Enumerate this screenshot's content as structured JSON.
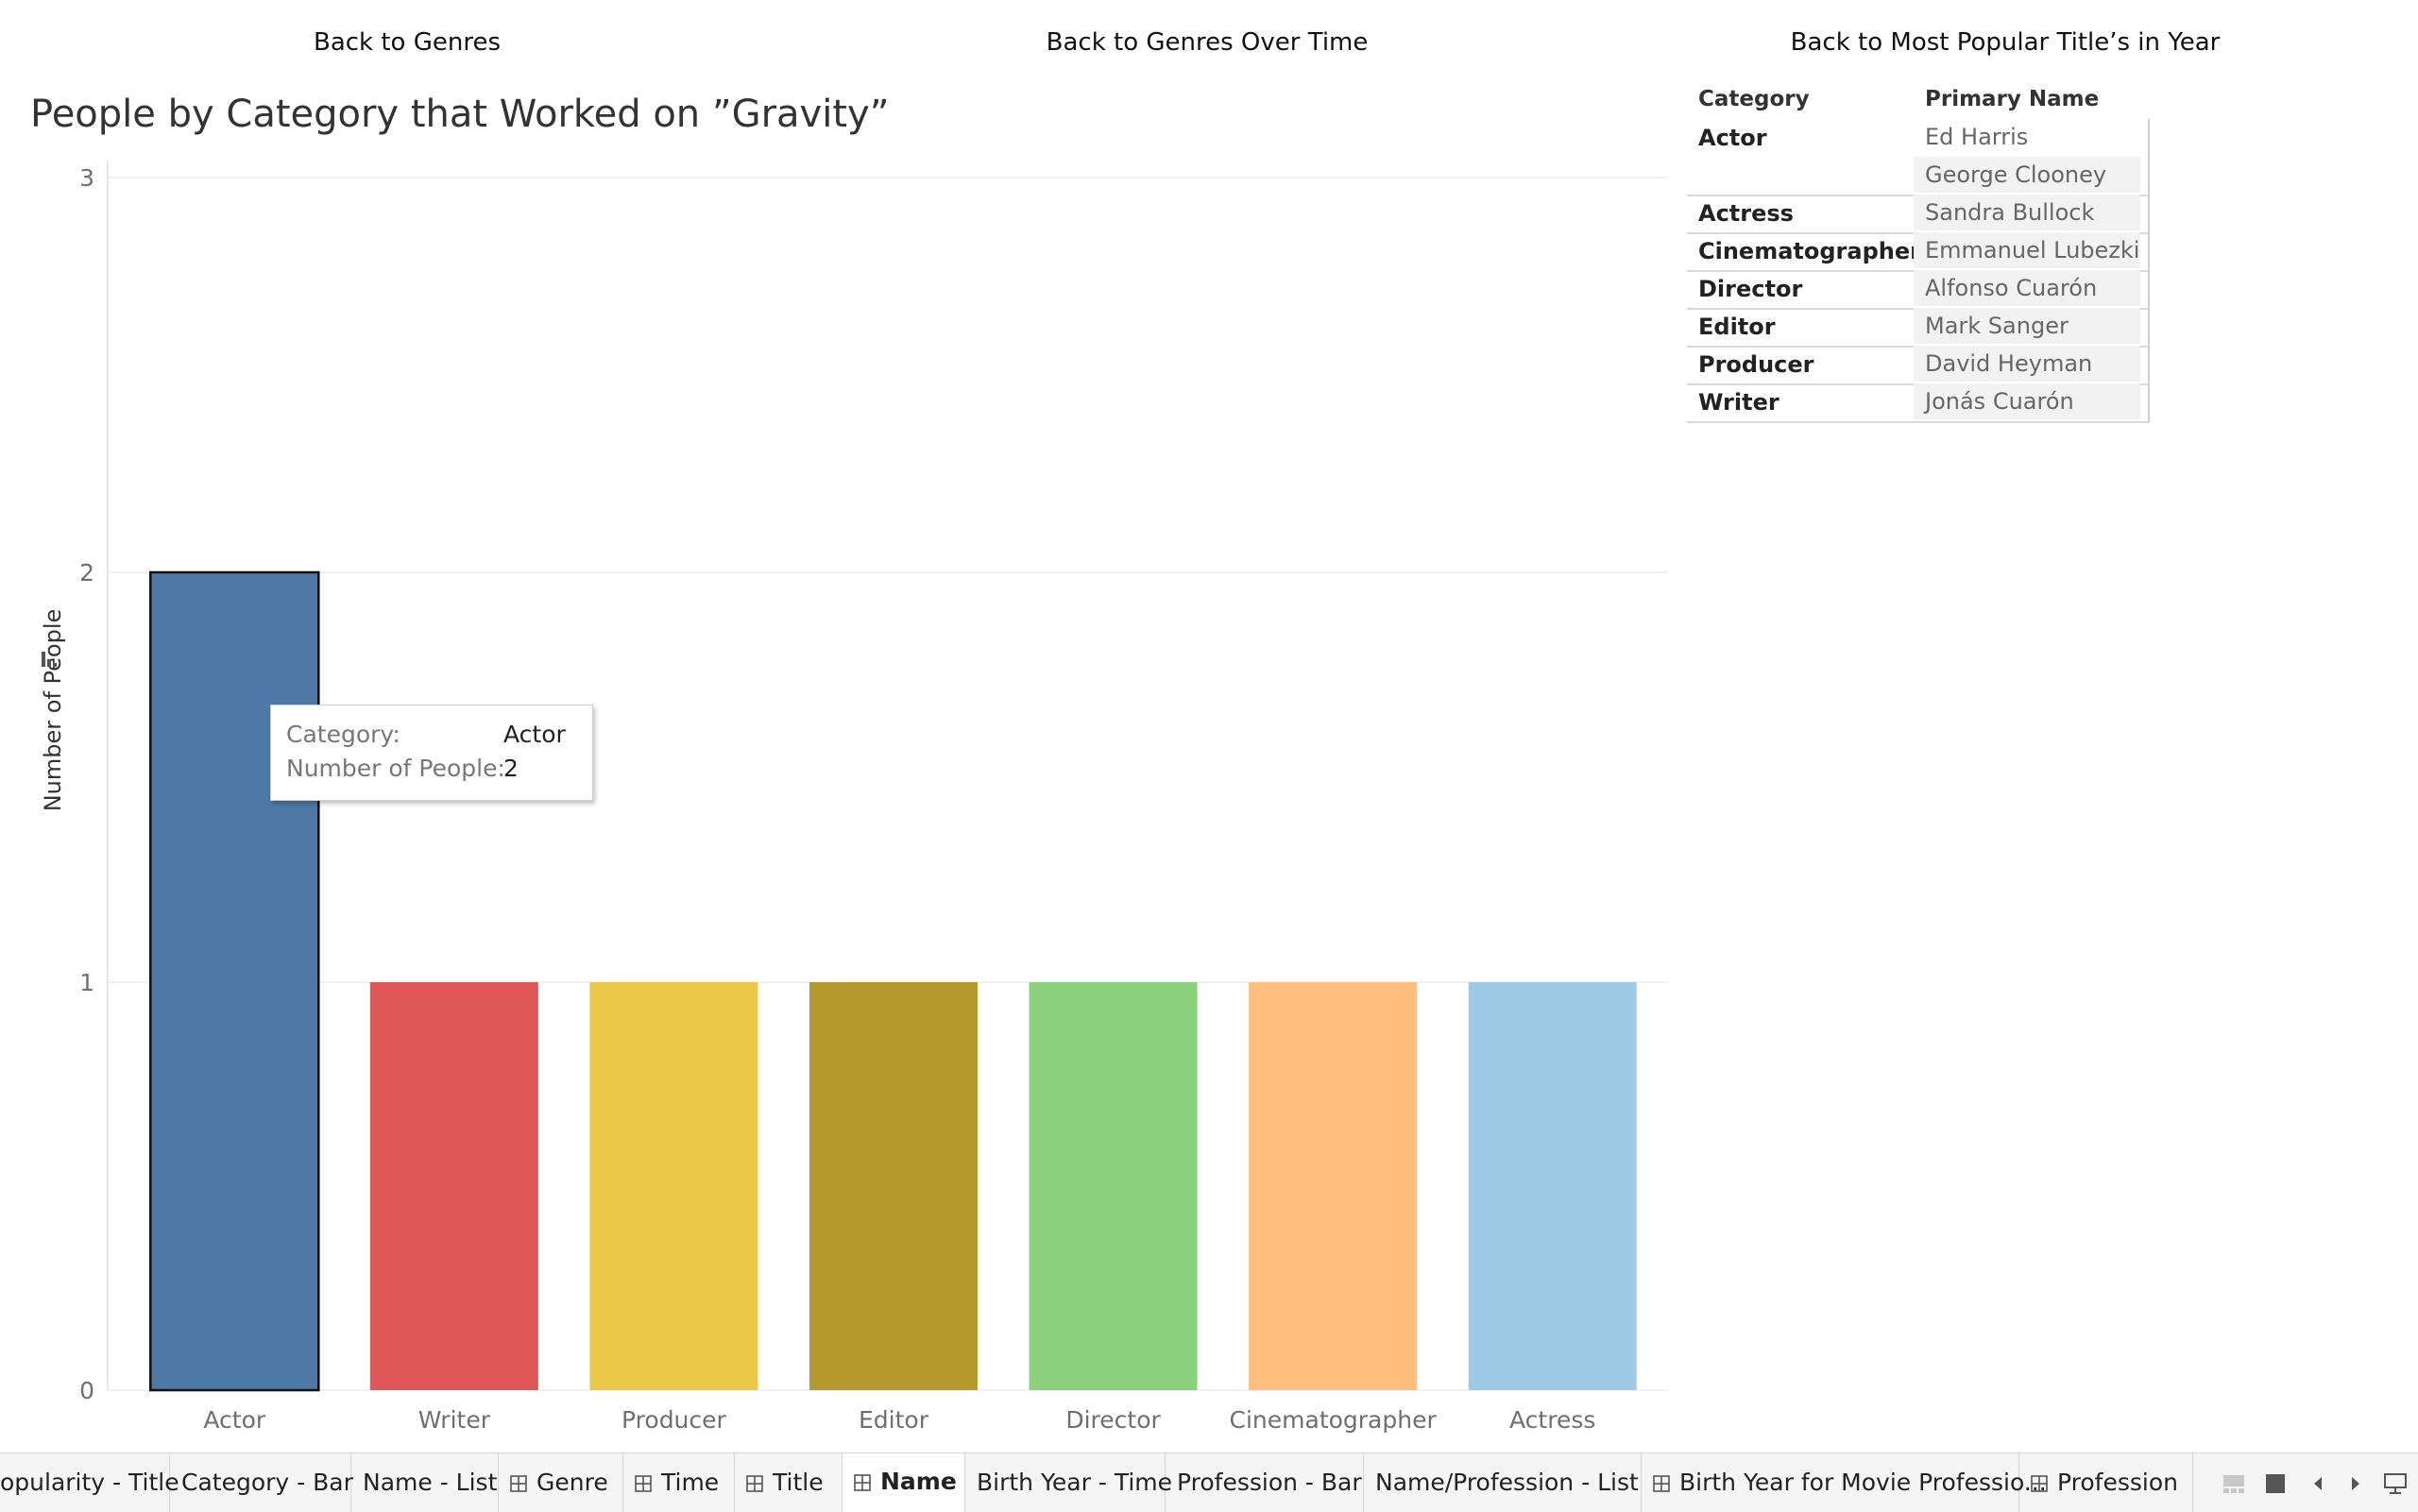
{
  "nav": {
    "back_genres": "Back to Genres",
    "back_genres_time": "Back to Genres Over Time",
    "back_popular": "Back to Most Popular Title’s in Year"
  },
  "chart_data": {
    "type": "bar",
    "title": "People by Category that Worked on ”Gravity”",
    "xlabel": "",
    "ylabel": "Number of People",
    "ylim": [
      0,
      3
    ],
    "yticks": [
      0,
      1,
      2,
      3
    ],
    "categories": [
      "Actor",
      "Writer",
      "Producer",
      "Editor",
      "Director",
      "Cinematographer",
      "Actress"
    ],
    "values": [
      2,
      1,
      1,
      1,
      1,
      1,
      1
    ],
    "colors": [
      "#4e79a7",
      "#e15759",
      "#edc949",
      "#b6992d",
      "#8cd17d",
      "#ffbe7d",
      "#9fcae6"
    ],
    "highlighted": "Actor",
    "grid": true,
    "legend": "none"
  },
  "tooltip": {
    "category_label": "Category:",
    "category_value": "Actor",
    "count_label": "Number of People:",
    "count_value": "2"
  },
  "table": {
    "headers": [
      "Category",
      "Primary Name"
    ],
    "rows": [
      {
        "category": "Actor",
        "names": [
          "Ed Harris",
          "George Clooney"
        ]
      },
      {
        "category": "Actress",
        "names": [
          "Sandra Bullock"
        ]
      },
      {
        "category": "Cinematographer",
        "names": [
          "Emmanuel Lubezki"
        ]
      },
      {
        "category": "Director",
        "names": [
          "Alfonso Cuarón"
        ]
      },
      {
        "category": "Editor",
        "names": [
          "Mark Sanger"
        ]
      },
      {
        "category": "Producer",
        "names": [
          "David Heyman"
        ]
      },
      {
        "category": "Writer",
        "names": [
          "Jonás Cuarón"
        ]
      }
    ]
  },
  "tabs": [
    {
      "label": "opularity - Title",
      "icon": "none"
    },
    {
      "label": "Category - Bar",
      "icon": "none"
    },
    {
      "label": "Name - List",
      "icon": "none"
    },
    {
      "label": "Genre",
      "icon": "dashboard-grid-icon"
    },
    {
      "label": "Time",
      "icon": "dashboard-grid-icon"
    },
    {
      "label": "Title",
      "icon": "dashboard-grid-icon"
    },
    {
      "label": "Name",
      "icon": "dashboard-grid-icon",
      "active": true
    },
    {
      "label": "Birth Year - Time",
      "icon": "none"
    },
    {
      "label": "Profession - Bar",
      "icon": "none"
    },
    {
      "label": "Name/Profession - List",
      "icon": "none"
    },
    {
      "label": "Birth Year for Movie Professio...",
      "icon": "dashboard-grid-icon"
    },
    {
      "label": "Profession",
      "icon": "dashboard-grid-icon"
    }
  ],
  "controls": [
    "filmstrip-icon",
    "grid-view-icon",
    "prev-arrow-icon",
    "next-arrow-icon",
    "presentation-icon"
  ]
}
